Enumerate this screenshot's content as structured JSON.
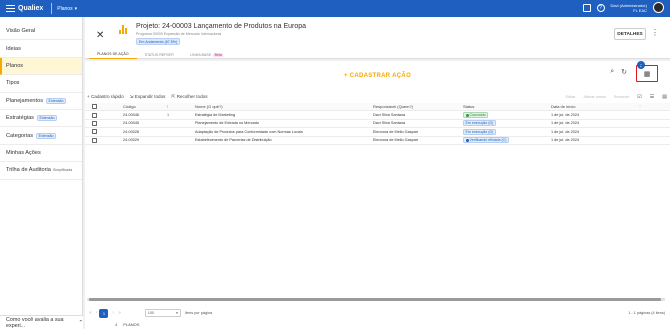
{
  "topbar": {
    "brand": "Qualiex",
    "module": "Planos",
    "user_name": "Davi (Administrador)",
    "user_org": "FL EAC"
  },
  "sidebar": {
    "items": [
      {
        "label": "Visão Geral"
      },
      {
        "label": "Ideias"
      },
      {
        "label": "Planos",
        "active": true
      },
      {
        "label": "Tipos"
      },
      {
        "label": "Planejamentos",
        "badge": "Extensão"
      },
      {
        "label": "Estratégias",
        "badge": "Extensão"
      },
      {
        "label": "Categorias",
        "badge": "Extensão"
      },
      {
        "label": "Minhas Ações"
      },
      {
        "label": "Trilha de Auditoria",
        "small": "Simplificada"
      }
    ],
    "rating_text": "Como você avalia a sua experi..."
  },
  "header": {
    "title": "Projeto: 24-00003 Lançamento de Produtos na Europa",
    "subtitle": "Programa 00009 Expansão de Mercado Internacional",
    "status": "Em Andamento (67.5%)",
    "tabs": [
      {
        "label": "PLANOS DE AÇÃO",
        "active": true
      },
      {
        "label": "STATUS REPORT"
      },
      {
        "label": "LINHA BASE",
        "badge": "Beta"
      }
    ],
    "details_button": "DETALHES"
  },
  "main": {
    "add_action": "+ CADASTRAR AÇÃO",
    "badge_count": "2",
    "toolbar": {
      "quick_add": "+ Cadastro rápido",
      "expand_all": "Expandir todos",
      "collapse_all": "Recolher todos",
      "edit": "Editar",
      "change_bulk": "Alterar vários",
      "remove": "Remover"
    },
    "columns": {
      "code": "Código",
      "what": "Nome (O quê?)",
      "who": "Responsável (Quem?)",
      "status": "Status",
      "date": "Data de início"
    },
    "rows": [
      {
        "code": "24-00046",
        "icon": "1",
        "what": "Estratégia de Marketing",
        "who": "Davi Silva Santana",
        "status": "Concluído",
        "status_type": "green",
        "date": "1 de jul. de 2024"
      },
      {
        "code": "24-00045",
        "icon": "",
        "what": "Planejamento de Entrada no Mercado",
        "who": "Davi Silva Santana",
        "status": "Em execução (D)",
        "status_type": "blue",
        "date": "1 de jul. de 2024"
      },
      {
        "code": "24-00028",
        "icon": "",
        "what": "Adaptação de Produtos para Conformidade com Normas Locais",
        "who": "Eleonora de Mello Gaspari",
        "status": "Em execução (D)",
        "status_type": "blue",
        "date": "1 de jul. de 2024"
      },
      {
        "code": "24-00029",
        "icon": "",
        "what": "Estabelecimento de Parcerias de Distribuição",
        "who": "Eleonora de Mello Gaspari",
        "status": "Verificando eficácia (C)",
        "status_type": "blue",
        "date": "1 de jul. de 2024"
      }
    ],
    "pager": {
      "current": "1",
      "per_page": "100",
      "per_page_label": "Itens por página",
      "info": "1 - 1 páginas (4 itens)"
    }
  },
  "bottom_tab": {
    "index": "4",
    "label": "PLANOS"
  }
}
